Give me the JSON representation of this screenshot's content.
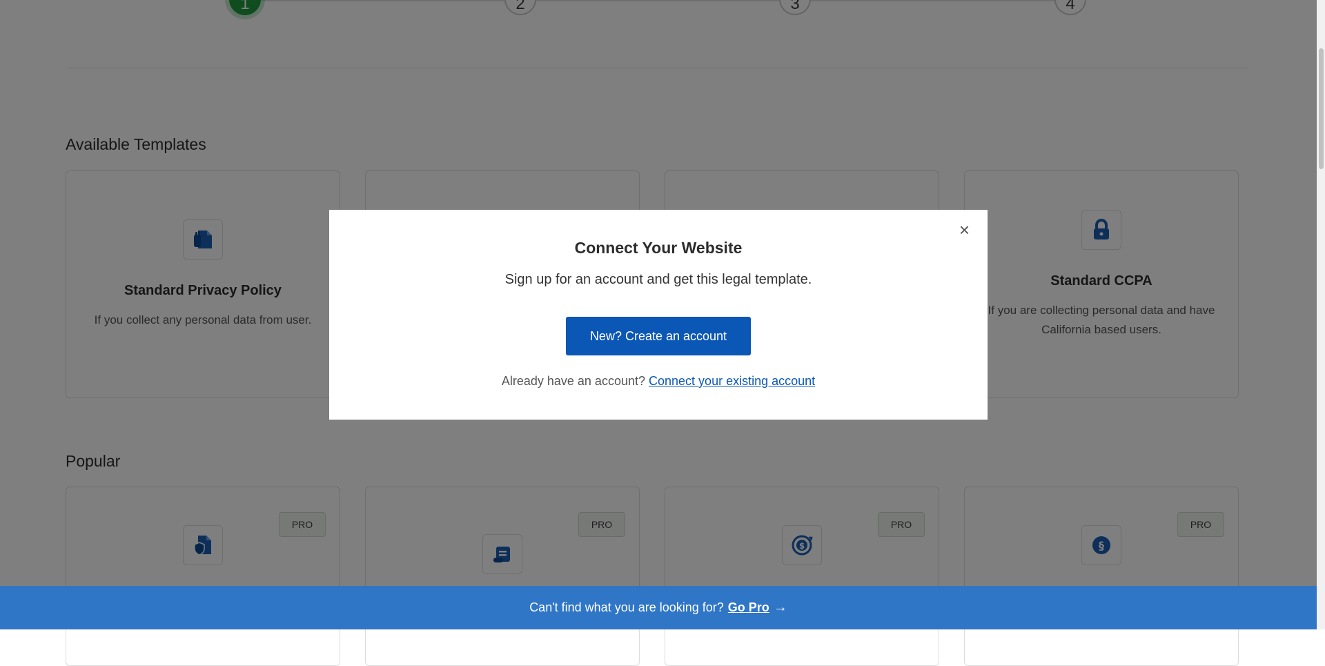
{
  "stepper": {
    "steps": [
      "1",
      "2",
      "3",
      "4"
    ],
    "active_step": "1"
  },
  "sections": {
    "available_title": "Available Templates",
    "popular_title": "Popular"
  },
  "available_templates": [
    {
      "title": "Standard Privacy Policy",
      "desc": "If you collect any personal data from user.",
      "icon": "document-hand-icon"
    },
    {
      "title": "",
      "desc": "",
      "icon": ""
    },
    {
      "title": "",
      "desc": "",
      "icon": ""
    },
    {
      "title": "Standard CCPA",
      "desc": "If you are collecting personal data and have California based users.",
      "icon": "lock-icon"
    }
  ],
  "popular_templates": [
    {
      "badge": "PRO",
      "icon": "document-shield-icon"
    },
    {
      "badge": "PRO",
      "icon": "scroll-icon"
    },
    {
      "badge": "PRO",
      "icon": "refund-icon"
    },
    {
      "badge": "PRO",
      "icon": "section-icon"
    }
  ],
  "modal": {
    "close_label": "×",
    "title": "Connect Your Website",
    "subtitle": "Sign up for an account and get this legal template.",
    "create_button": "New? Create an account",
    "foot_text": "Already have an account?",
    "foot_link": "Connect your existing account"
  },
  "banner": {
    "text": "Can't find what you are looking for?",
    "link": "Go Pro",
    "arrow": "→"
  },
  "colors": {
    "primary": "#0b57b5",
    "banner": "#2f76c7",
    "step_active": "#1e9a3c"
  }
}
